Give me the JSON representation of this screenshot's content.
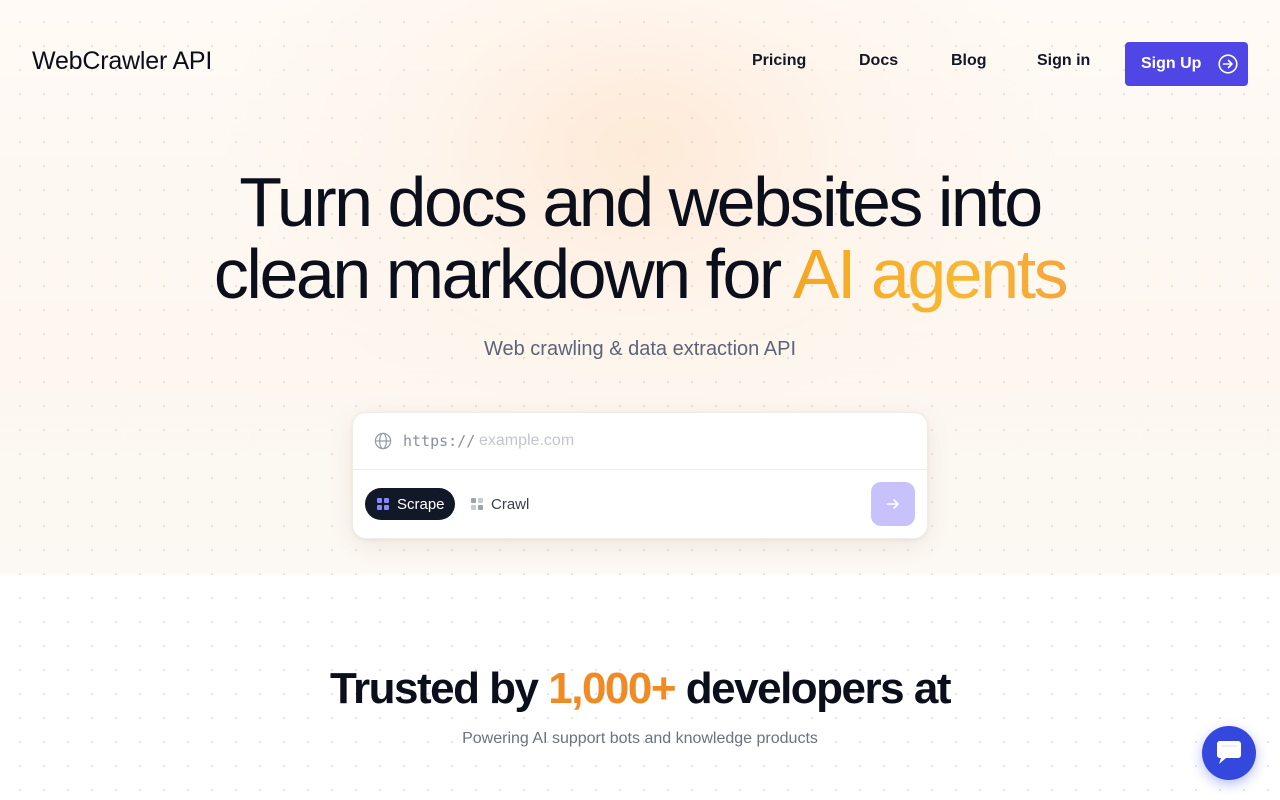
{
  "header": {
    "brand": "WebCrawler API",
    "nav": {
      "pricing": "Pricing",
      "docs": "Docs",
      "blog": "Blog",
      "signin": "Sign in"
    },
    "signup_label": "Sign Up"
  },
  "hero": {
    "headline_line1": "Turn docs and websites into",
    "headline_line2_prefix": "clean markdown for ",
    "headline_accent": "AI agents",
    "subhead": "Web crawling & data extraction API"
  },
  "crawl_form": {
    "scheme": "https://",
    "url_value": "",
    "url_placeholder": "example.com",
    "modes": {
      "scrape": "Scrape",
      "crawl": "Crawl"
    },
    "selected_mode": "Scrape"
  },
  "trusted": {
    "prefix": "Trusted by ",
    "count": "1,000+",
    "suffix": " developers at",
    "subtitle": "Powering AI support bots and knowledge products"
  },
  "colors": {
    "primary": "#4f46e5",
    "accent_orange": "#f08a24",
    "accent_gold": "#f5a623",
    "dark": "#0b0f1c",
    "chat": "#3448dd"
  },
  "icons": {
    "signup": "arrow-right-circle-icon",
    "url": "globe-icon",
    "mode": "grid-icon",
    "submit": "arrow-right-icon",
    "chat": "chat-bubble-icon"
  }
}
